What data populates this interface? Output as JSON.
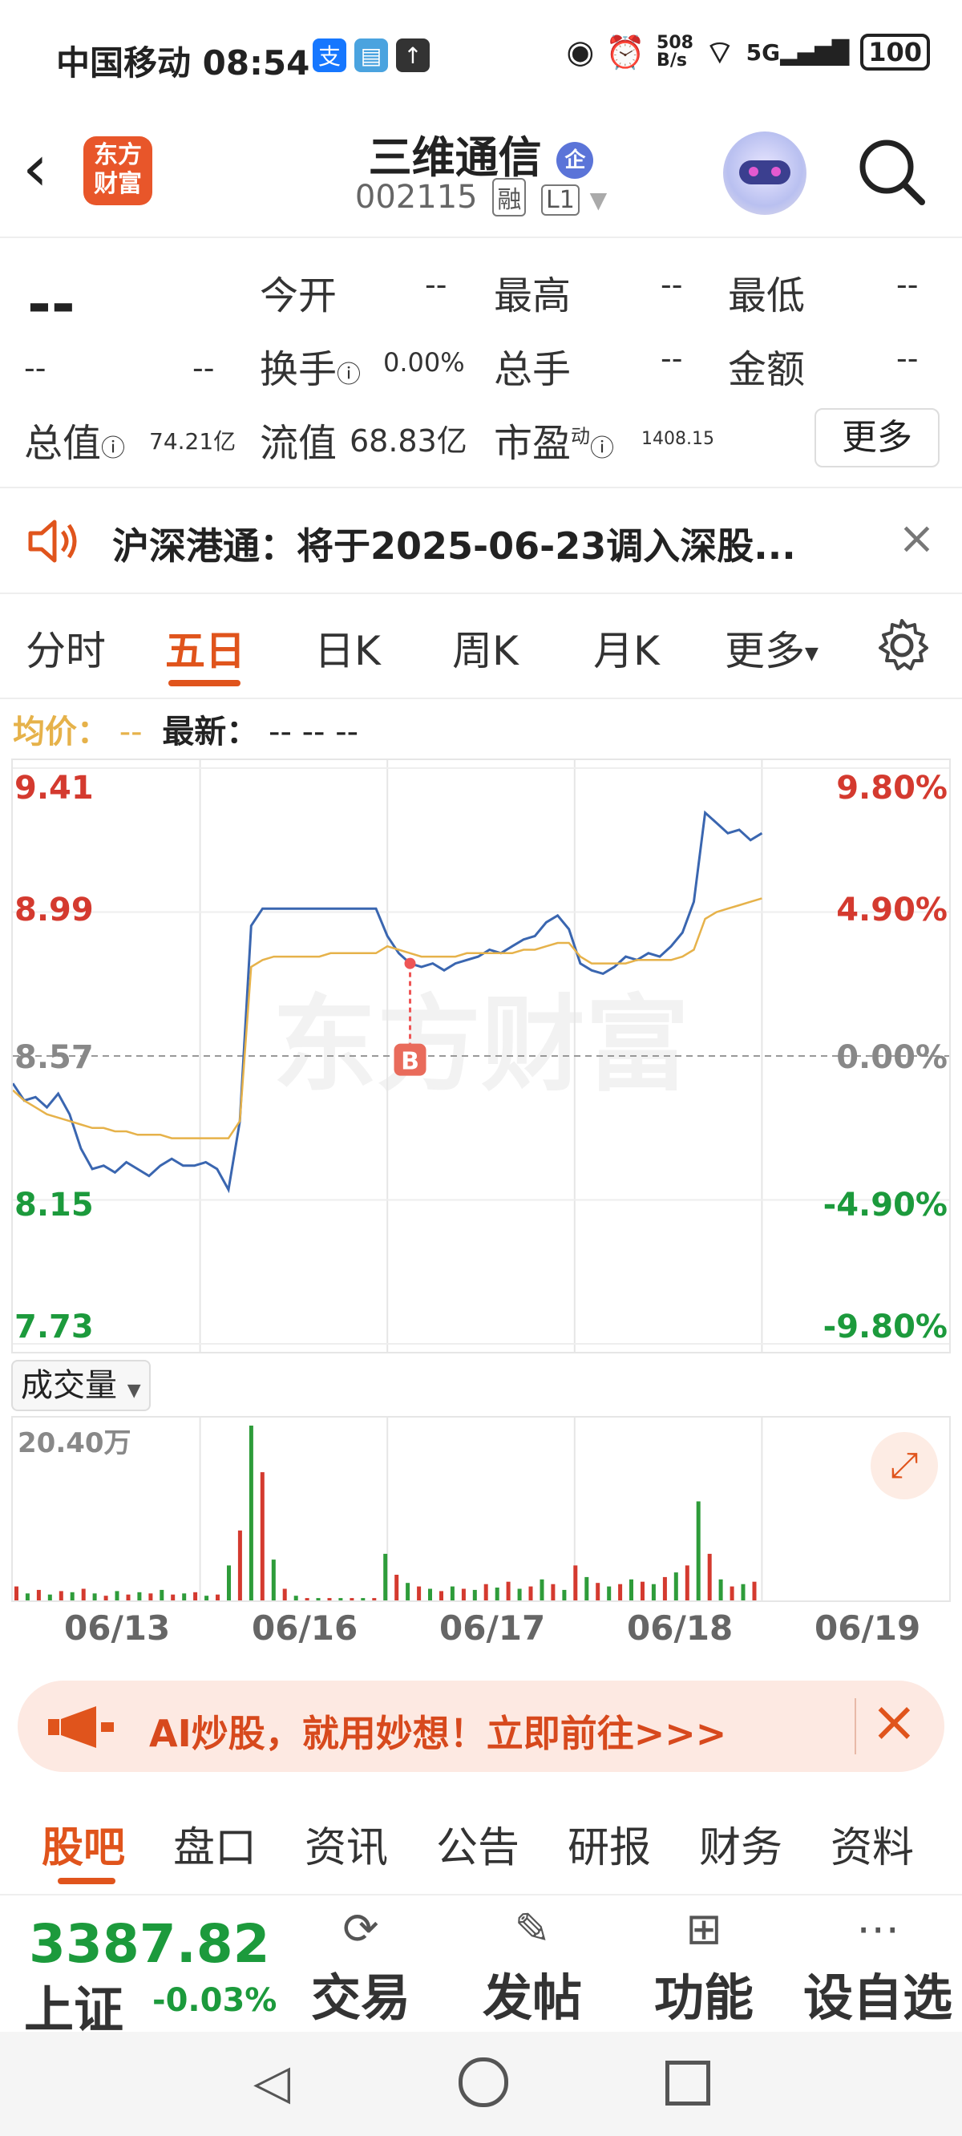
{
  "status_bar": {
    "carrier_time": "中国移动 08:54",
    "net_speed_top": "508",
    "net_speed_bottom": "B/s",
    "signal_label": "5G",
    "battery": "100"
  },
  "header": {
    "logo_line1": "东方",
    "logo_line2": "财富",
    "stock_name": "三维通信",
    "stock_tag": "企",
    "stock_code": "002115",
    "margin_badge": "融",
    "level_badge": "L1"
  },
  "quote": {
    "price": "--",
    "change_amount": "--",
    "change_pct": "--",
    "open_label": "今开",
    "open_value": "--",
    "high_label": "最高",
    "high_value": "--",
    "low_label": "最低",
    "low_value": "--",
    "turnover_label": "换手",
    "turnover_value": "0.00%",
    "volume_label": "总手",
    "volume_value": "--",
    "amount_label": "金额",
    "amount_value": "--",
    "mktcap_label": "总值",
    "mktcap_value": "74.21亿",
    "float_label": "流值",
    "float_value": "68.83亿",
    "pe_label": "市盈",
    "pe_sup": "动",
    "pe_value": "1408.15",
    "more_label": "更多"
  },
  "notice": {
    "text": "沪深港通：将于2025-06-23调入深股..."
  },
  "tabs": {
    "items": [
      "分时",
      "五日",
      "日K",
      "周K",
      "月K",
      "更多"
    ],
    "active": "五日"
  },
  "price_line": {
    "avg_label": "均价：",
    "avg_value": "--",
    "latest_label": "最新：",
    "latest_values": "--  --  --"
  },
  "chart_data": {
    "type": "line",
    "title": "",
    "y_left_ticks": [
      "9.41",
      "8.99",
      "8.57",
      "8.15",
      "7.73"
    ],
    "y_right_ticks": [
      "9.80%",
      "4.90%",
      "0.00%",
      "-4.90%",
      "-9.80%"
    ],
    "ylim": [
      7.73,
      9.41
    ],
    "prev_close": 8.57,
    "x_days": [
      "06/13",
      "06/16",
      "06/17",
      "06/18",
      "06/19"
    ],
    "watermark": "东方财富",
    "buy_marker": "B",
    "series": [
      {
        "color": "#3a66b0",
        "values": [
          8.49,
          8.44,
          8.45,
          8.42,
          8.46,
          8.4,
          8.3,
          8.24,
          8.25,
          8.23,
          8.26,
          8.24,
          8.22,
          8.25,
          8.27,
          8.25,
          8.25,
          8.26,
          8.24,
          8.18,
          8.38,
          8.95,
          9.0,
          9.0,
          9.0,
          9.0,
          9.0,
          9.0,
          9.0,
          9.0,
          9.0,
          9.0,
          9.0,
          8.92,
          8.87,
          8.84,
          8.83,
          8.84,
          8.82,
          8.84,
          8.85,
          8.86,
          8.88,
          8.87,
          8.89,
          8.91,
          8.92,
          8.96,
          8.98,
          8.94,
          8.84,
          8.82,
          8.81,
          8.83,
          8.86,
          8.85,
          8.87,
          8.86,
          8.89,
          8.93,
          9.02,
          9.28,
          9.25,
          9.22,
          9.23,
          9.2,
          9.22
        ]
      },
      {
        "color": "#e6b24a",
        "values": [
          8.47,
          8.44,
          8.42,
          8.4,
          8.39,
          8.38,
          8.37,
          8.36,
          8.36,
          8.35,
          8.35,
          8.34,
          8.34,
          8.34,
          8.33,
          8.33,
          8.33,
          8.33,
          8.33,
          8.33,
          8.38,
          8.83,
          8.85,
          8.86,
          8.86,
          8.86,
          8.86,
          8.86,
          8.87,
          8.87,
          8.87,
          8.87,
          8.87,
          8.89,
          8.88,
          8.87,
          8.86,
          8.86,
          8.86,
          8.86,
          8.87,
          8.87,
          8.87,
          8.87,
          8.87,
          8.88,
          8.88,
          8.89,
          8.9,
          8.9,
          8.86,
          8.84,
          8.84,
          8.84,
          8.84,
          8.85,
          8.85,
          8.85,
          8.85,
          8.86,
          8.88,
          8.97,
          8.99,
          9.0,
          9.01,
          9.02,
          9.03
        ]
      }
    ]
  },
  "volume": {
    "label": "成交量",
    "max_label": "20.40万",
    "bars": [
      12,
      6,
      9,
      5,
      8,
      7,
      10,
      6,
      4,
      8,
      5,
      7,
      6,
      9,
      5,
      6,
      7,
      4,
      5,
      30,
      60,
      150,
      110,
      35,
      10,
      4,
      2,
      2,
      2,
      2,
      2,
      2,
      2,
      40,
      22,
      15,
      12,
      10,
      8,
      12,
      10,
      9,
      14,
      11,
      16,
      10,
      12,
      18,
      14,
      9,
      30,
      20,
      15,
      12,
      14,
      18,
      16,
      14,
      20,
      24,
      30,
      85,
      40,
      18,
      12,
      14,
      16
    ],
    "bar_colors": [
      "#d43a2f",
      "#2e9c3a"
    ]
  },
  "ai_banner": {
    "text": "AI炒股，就用妙想！立即前往>>>"
  },
  "bottom_tabs": {
    "items": [
      "股吧",
      "盘口",
      "资讯",
      "公告",
      "研报",
      "财务",
      "资料"
    ],
    "active": "股吧"
  },
  "footer": {
    "index_value": "3387.82",
    "index_name": "上证",
    "index_change": "-0.03%",
    "buttons": [
      {
        "label": "交易",
        "icon": "yen-exchange-icon"
      },
      {
        "label": "发帖",
        "icon": "edit-icon"
      },
      {
        "label": "功能",
        "icon": "grid-icon"
      },
      {
        "label": "设自选",
        "icon": "more-dots-icon"
      }
    ]
  },
  "colors": {
    "accent": "#e0541c",
    "up": "#d43a2f",
    "down": "#1c9a3c"
  }
}
